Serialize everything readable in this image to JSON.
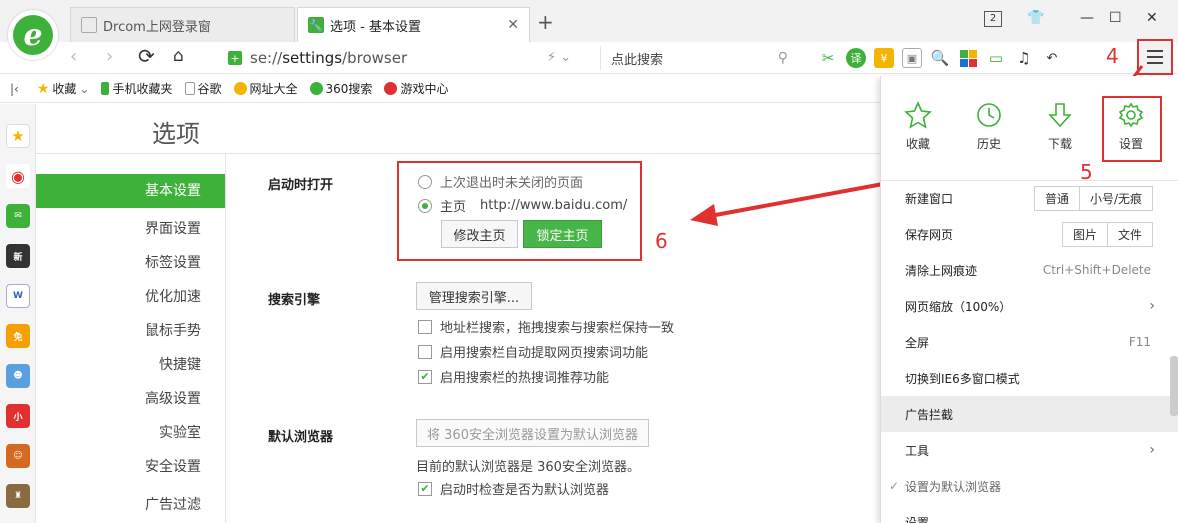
{
  "tabs": [
    {
      "title": "Drcom上网登录窗"
    },
    {
      "title": "选项 - 基本设置"
    }
  ],
  "window": {
    "count_badge": "2"
  },
  "address": {
    "url_prefix": "se://",
    "url_bold": "settings",
    "url_suffix": "/browser",
    "search_placeholder": "点此搜索"
  },
  "bookmarks": [
    {
      "label": "收藏",
      "icon": "star-icon"
    },
    {
      "label": "手机收藏夹",
      "icon": "phone-icon"
    },
    {
      "label": "谷歌",
      "icon": "page-icon"
    },
    {
      "label": "网址大全",
      "icon": "globe-icon"
    },
    {
      "label": "360搜索",
      "icon": "search-360-icon"
    },
    {
      "label": "游戏中心",
      "icon": "game-icon"
    }
  ],
  "page": {
    "title": "选项",
    "nav": [
      "基本设置",
      "界面设置",
      "标签设置",
      "优化加速",
      "鼠标手势",
      "快捷键",
      "高级设置",
      "实验室",
      "安全设置",
      "广告过滤"
    ],
    "startup": {
      "label": "启动时打开",
      "opt_last": "上次退出时未关闭的页面",
      "opt_home": "主页",
      "home_url": "http://www.baidu.com/",
      "btn_edit": "修改主页",
      "btn_lock": "锁定主页"
    },
    "search": {
      "label": "搜索引擎",
      "btn_manage": "管理搜索引擎...",
      "chk1": "地址栏搜索，拖拽搜索与搜索栏保持一致",
      "chk2": "启用搜索栏自动提取网页搜索词功能",
      "chk3": "启用搜索栏的热搜词推荐功能"
    },
    "default_browser": {
      "label": "默认浏览器",
      "btn_set": "将 360安全浏览器设置为默认浏览器",
      "status": "目前的默认浏览器是 360安全浏览器。",
      "chk_check": "启动时检查是否为默认浏览器"
    }
  },
  "menu": {
    "icons": [
      {
        "label": "收藏"
      },
      {
        "label": "历史"
      },
      {
        "label": "下载"
      },
      {
        "label": "设置"
      }
    ],
    "new_window": "新建窗口",
    "new_window_opts": [
      "普通",
      "小号/无痕"
    ],
    "save_page": "保存网页",
    "save_page_opts": [
      "图片",
      "文件"
    ],
    "clear_history": "清除上网痕迹",
    "clear_shortcut": "Ctrl+Shift+Delete",
    "zoom": "网页缩放（100%）",
    "fullscreen": "全屏",
    "fullscreen_key": "F11",
    "ie6": "切换到IE6多窗口模式",
    "adblock": "广告拦截",
    "tools": "工具",
    "set_default": "设置为默认浏览器",
    "settings_cut": "设置"
  },
  "annotations": {
    "n4": "4",
    "n5": "5",
    "n6": "6"
  },
  "colors": {
    "accent": "#3db13a",
    "annotation": "#e03030"
  }
}
